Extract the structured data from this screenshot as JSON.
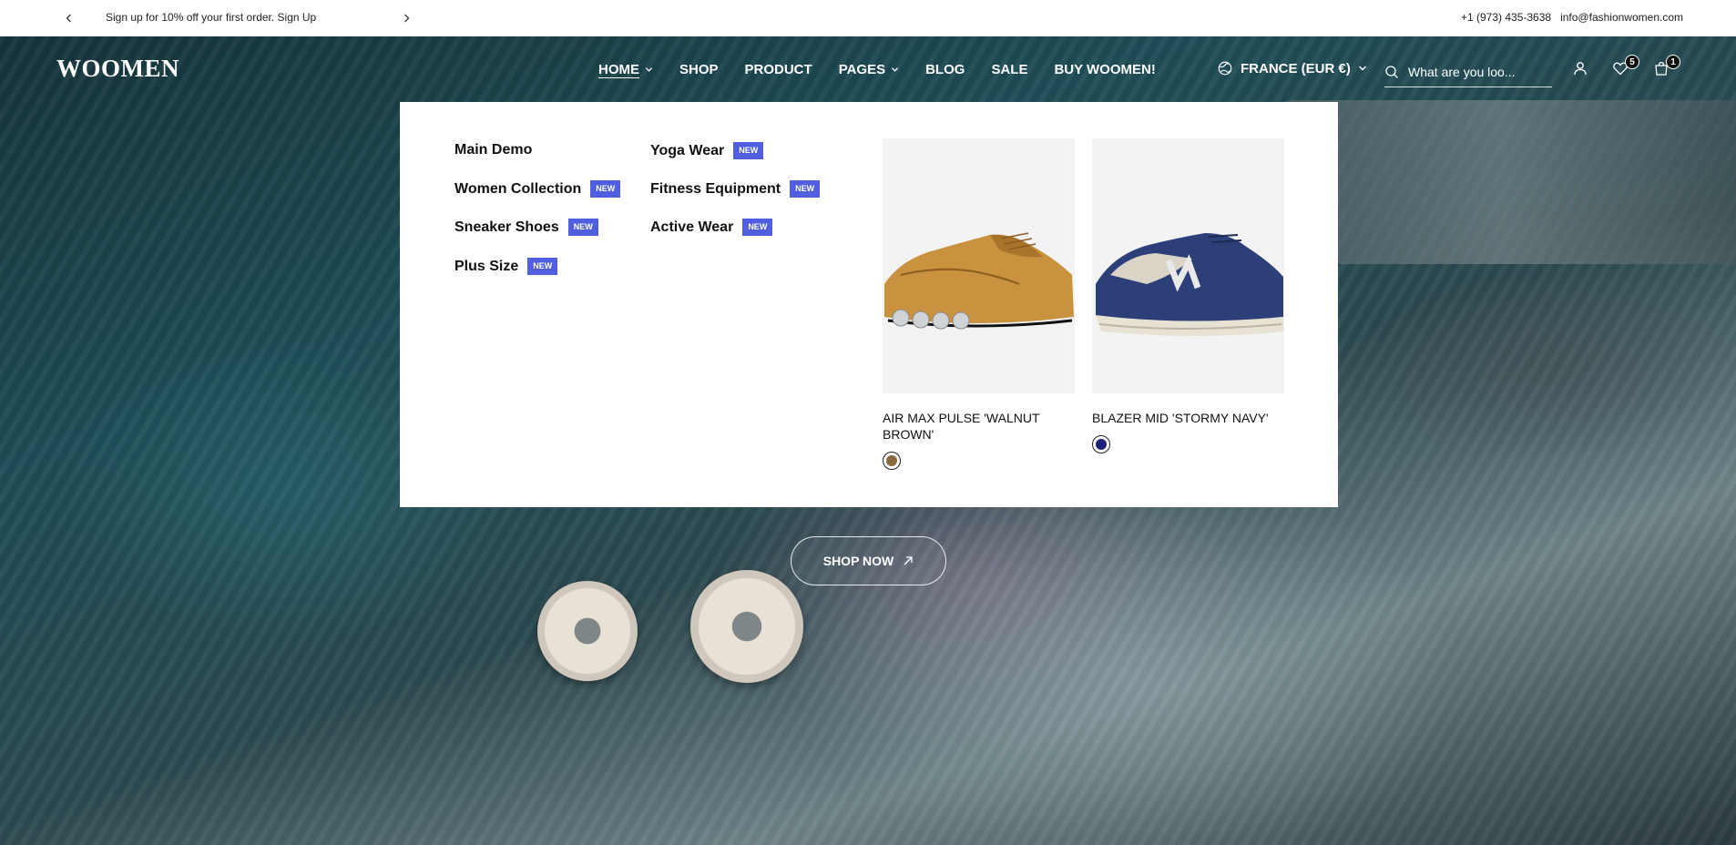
{
  "announcement": {
    "text": "Sign up for 10% off your first order. Sign Up",
    "phone": "+1 (973) 435-3638",
    "email": "info@fashionwomen.com"
  },
  "header": {
    "logo": "WOOMEN",
    "nav": [
      {
        "label": "HOME",
        "dropdown": true,
        "active": true
      },
      {
        "label": "SHOP",
        "dropdown": false
      },
      {
        "label": "PRODUCT",
        "dropdown": false
      },
      {
        "label": "PAGES",
        "dropdown": true
      },
      {
        "label": "BLOG",
        "dropdown": false
      },
      {
        "label": "SALE",
        "dropdown": false
      },
      {
        "label": "BUY WOOMEN!",
        "dropdown": false
      }
    ],
    "locale": "FRANCE (EUR €)",
    "search_placeholder": "What are you loo...",
    "wishlist_count": "5",
    "cart_count": "1"
  },
  "mega_menu": {
    "badge_label": "NEW",
    "column1": [
      {
        "label": "Main Demo",
        "new": false
      },
      {
        "label": "Women Collection",
        "new": true
      },
      {
        "label": "Sneaker Shoes",
        "new": true
      },
      {
        "label": "Plus Size",
        "new": true
      }
    ],
    "column2": [
      {
        "label": "Yoga Wear",
        "new": true
      },
      {
        "label": "Fitness Equipment",
        "new": true
      },
      {
        "label": "Active Wear",
        "new": true
      }
    ],
    "products": [
      {
        "name": "AIR MAX PULSE 'WALNUT BROWN'",
        "swatch_color": "#8a6a3a"
      },
      {
        "name": "BLAZER MID 'STORMY NAVY'",
        "swatch_color": "#1c1f7a"
      }
    ]
  },
  "hero": {
    "cta_label": "SHOP NOW"
  },
  "colors": {
    "badge": "#4f5fe0",
    "text": "#111111"
  }
}
